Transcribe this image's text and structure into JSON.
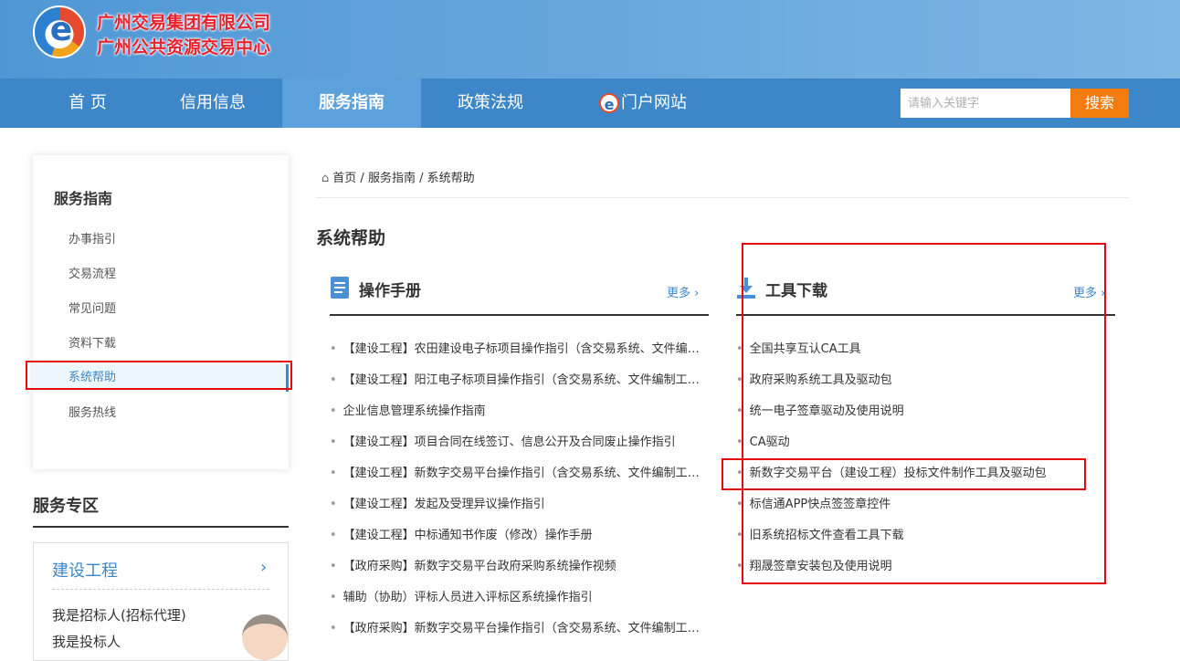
{
  "header": {
    "company_name": "广州交易集团有限公司",
    "center_name": "广州公共资源交易中心",
    "logo_letter": "e"
  },
  "nav": {
    "items": [
      "首 页",
      "信用信息",
      "服务指南",
      "政策法规",
      "门户网站"
    ],
    "portal_icon_letter": "e",
    "search_placeholder": "请输入关键字",
    "search_button": "搜索"
  },
  "sidebar": {
    "title": "服务指南",
    "items": [
      "办事指引",
      "交易流程",
      "常见问题",
      "资料下载",
      "系统帮助",
      "服务热线"
    ],
    "active_index": 4
  },
  "service_zone": {
    "title": "服务专区",
    "panel_title": "建设工程",
    "panel_chevron": "›",
    "links": [
      "我是招标人(招标代理)",
      "我是投标人"
    ]
  },
  "breadcrumb": {
    "home_icon": "⌂",
    "items": [
      "首页",
      "服务指南",
      "系统帮助"
    ],
    "separator": "/"
  },
  "page_title": "系统帮助",
  "manual": {
    "title": "操作手册",
    "more": "更多 ›",
    "items": [
      "【建设工程】农田建设电子标项目操作指引（含交易系统、文件编制工具）",
      "【建设工程】阳江电子标项目操作指引（含交易系统、文件编制工具）",
      "企业信息管理系统操作指南",
      "【建设工程】项目合同在线签订、信息公开及合同废止操作指引",
      "【建设工程】新数字交易平台操作指引（含交易系统、文件编制工具）",
      "【建设工程】发起及受理异议操作指引",
      "【建设工程】中标通知书作废（修改）操作手册",
      "【政府采购】新数字交易平台政府采购系统操作视频",
      "辅助（协助）评标人员进入评标区系统操作指引",
      "【政府采购】新数字交易平台操作指引（含交易系统、文件编制工具）"
    ]
  },
  "tools": {
    "title": "工具下载",
    "more": "更多 ›",
    "items": [
      "全国共享互认CA工具",
      "政府采购系统工具及驱动包",
      "统一电子签章驱动及使用说明",
      "CA驱动",
      "新数字交易平台（建设工程）投标文件制作工具及驱动包",
      "标信通APP快点签签章控件",
      "旧系统招标文件查看工具下载",
      "翔晟签章安装包及使用说明"
    ]
  },
  "colors": {
    "nav_bg": "#3d87c9",
    "nav_active": "#5da1dc",
    "search_button": "#f47c0f",
    "highlight_box": "#e20b0b",
    "brand_red": "#e7232e"
  }
}
